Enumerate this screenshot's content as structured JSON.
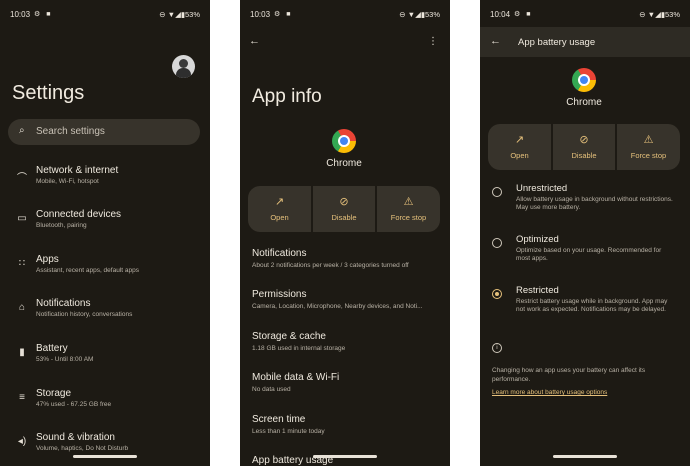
{
  "status": {
    "panel1": {
      "time": "10:03",
      "left_icons": "⚙ ■",
      "right": "⊖ ▼◢▮53%"
    },
    "panel2": {
      "time": "10:03",
      "left_icons": "⚙ ■",
      "right": "⊖ ▼◢▮53%"
    },
    "panel3": {
      "time": "10:04",
      "left_icons": "⚙ ■",
      "right": "⊖ ▼◢▮53%"
    }
  },
  "settings": {
    "title": "Settings",
    "search_placeholder": "Search settings",
    "items": [
      {
        "icon": "wifi-icon",
        "glyph": "⌒",
        "title": "Network & internet",
        "subtitle": "Mobile, Wi-Fi, hotspot"
      },
      {
        "icon": "devices-icon",
        "glyph": "▭",
        "title": "Connected devices",
        "subtitle": "Bluetooth, pairing"
      },
      {
        "icon": "apps-icon",
        "glyph": "∷",
        "title": "Apps",
        "subtitle": "Assistant, recent apps, default apps"
      },
      {
        "icon": "bell-icon",
        "glyph": "⌂",
        "title": "Notifications",
        "subtitle": "Notification history, conversations"
      },
      {
        "icon": "battery-icon",
        "glyph": "▮",
        "title": "Battery",
        "subtitle": "53% - Until 8:00 AM"
      },
      {
        "icon": "storage-icon",
        "glyph": "≡",
        "title": "Storage",
        "subtitle": "47% used - 67.25 GB free"
      },
      {
        "icon": "sound-icon",
        "glyph": "◂)",
        "title": "Sound & vibration",
        "subtitle": "Volume, haptics, Do Not Disturb"
      }
    ]
  },
  "app_info": {
    "back_glyph": "←",
    "menu_glyph": "⋮",
    "title": "App info",
    "app_name": "Chrome",
    "actions": [
      {
        "icon": "open-icon",
        "glyph": "↗",
        "label": "Open"
      },
      {
        "icon": "disable-icon",
        "glyph": "⊘",
        "label": "Disable"
      },
      {
        "icon": "warning-icon",
        "glyph": "⚠",
        "label": "Force stop"
      }
    ],
    "items": [
      {
        "title": "Notifications",
        "subtitle": "About 2 notifications per week / 3 categories turned off"
      },
      {
        "title": "Permissions",
        "subtitle": "Camera, Location, Microphone, Nearby devices, and Noti..."
      },
      {
        "title": "Storage & cache",
        "subtitle": "1.18 GB used in internal storage"
      },
      {
        "title": "Mobile data & Wi-Fi",
        "subtitle": "No data used"
      },
      {
        "title": "Screen time",
        "subtitle": "Less than 1 minute today"
      },
      {
        "title": "App battery usage",
        "subtitle": ""
      }
    ]
  },
  "battery_usage": {
    "back_glyph": "←",
    "title": "App battery usage",
    "app_name": "Chrome",
    "actions": [
      {
        "icon": "open-icon",
        "glyph": "↗",
        "label": "Open"
      },
      {
        "icon": "disable-icon",
        "glyph": "⊘",
        "label": "Disable"
      },
      {
        "icon": "warning-icon",
        "glyph": "⚠",
        "label": "Force stop"
      }
    ],
    "options": [
      {
        "title": "Unrestricted",
        "description": "Allow battery usage in background without restrictions. May use more battery.",
        "selected": false
      },
      {
        "title": "Optimized",
        "description": "Optimize based on your usage. Recommended for most apps.",
        "selected": false
      },
      {
        "title": "Restricted",
        "description": "Restrict battery usage while in background. App may not work as expected. Notifications may be delayed.",
        "selected": true
      }
    ],
    "info_glyph": "i",
    "note": "Changing how an app uses your battery can affect its performance.",
    "learn_more": "Learn more about battery usage options"
  },
  "colors": {
    "background": "#1d1a14",
    "surface": "#37332b",
    "accent": "#e5c07b"
  }
}
